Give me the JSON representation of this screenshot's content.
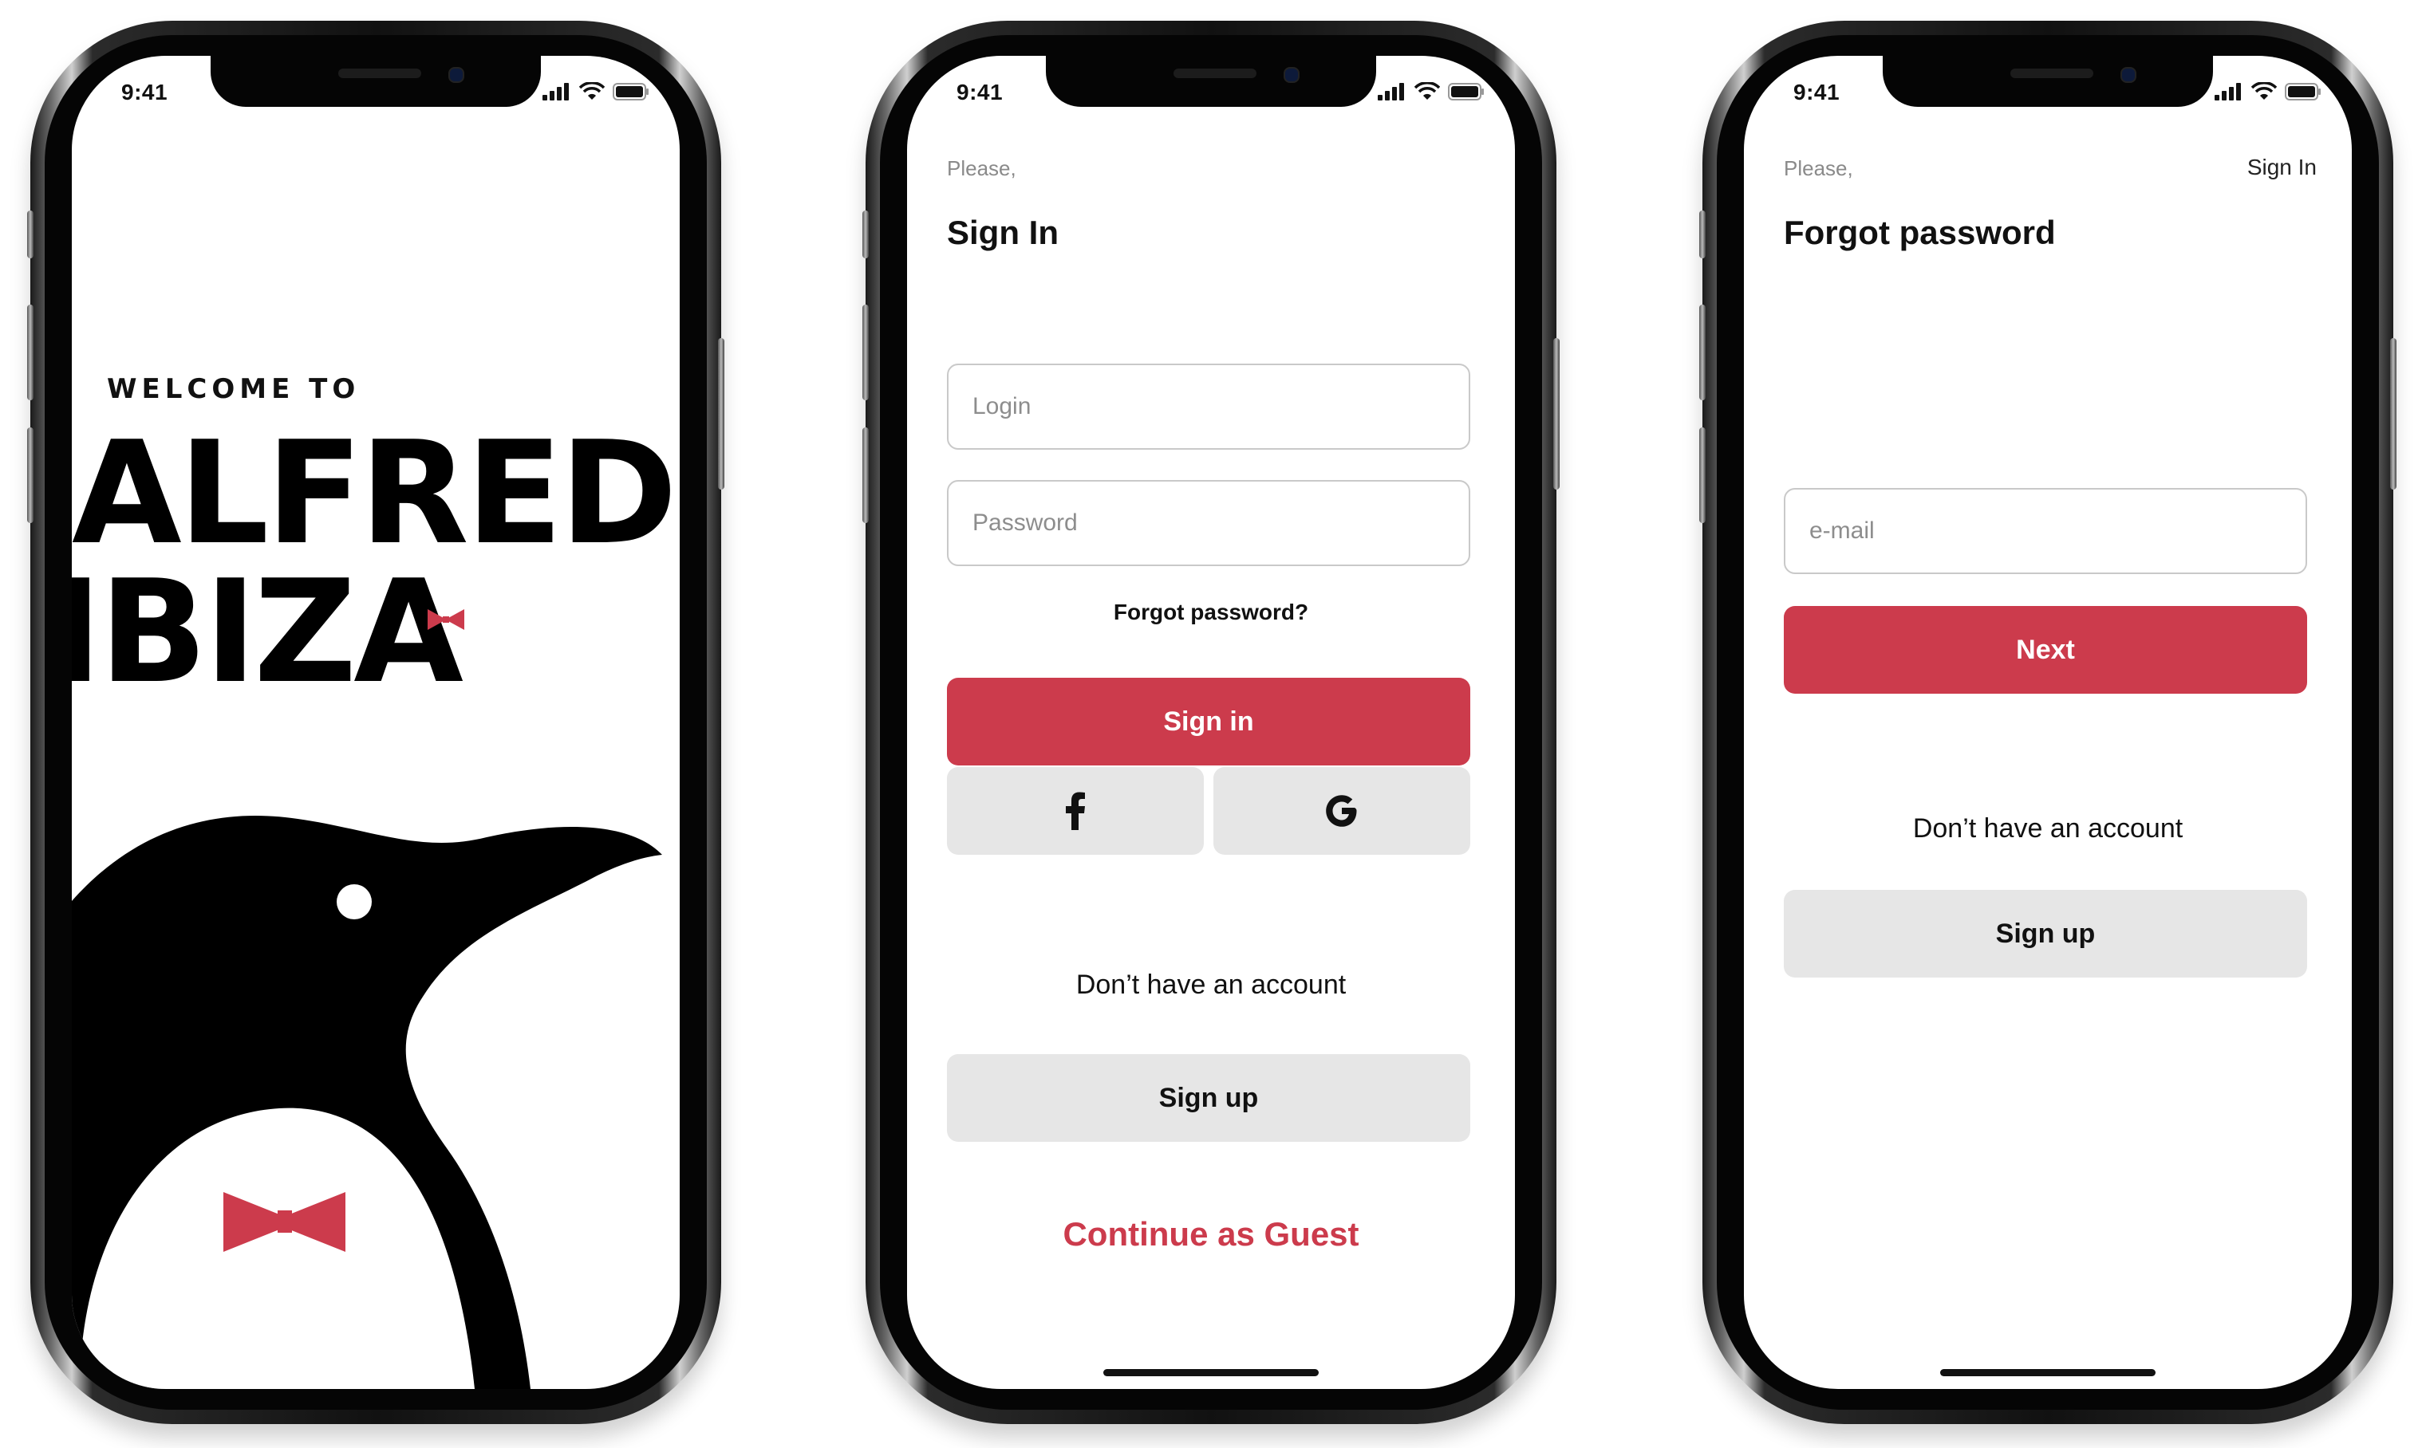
{
  "status_bar": {
    "time": "9:41"
  },
  "welcome": {
    "subtitle": "WELCOME TO",
    "brand_line1": "ALFRED",
    "brand_line2": "IBIZA",
    "accent_color": "#cc3b4c"
  },
  "sign_in": {
    "greeting": "Please,",
    "title": "Sign In",
    "login_placeholder": "Login",
    "password_placeholder": "Password",
    "forgot_link": "Forgot password?",
    "sign_in_button": "Sign in",
    "facebook_icon": "facebook-icon",
    "google_icon": "google-icon",
    "no_account_text": "Don’t have an account",
    "sign_up_button": "Sign up",
    "guest_link": "Continue as Guest"
  },
  "forgot_password": {
    "greeting": "Please,",
    "top_right_link": "Sign In",
    "title": "Forgot password",
    "email_placeholder": "e-mail",
    "next_button": "Next",
    "no_account_text": "Don’t have an account",
    "sign_up_button": "Sign up"
  },
  "colors": {
    "primary": "#cc3b4c",
    "secondary_button": "#e6e6e6",
    "text": "#111111"
  }
}
